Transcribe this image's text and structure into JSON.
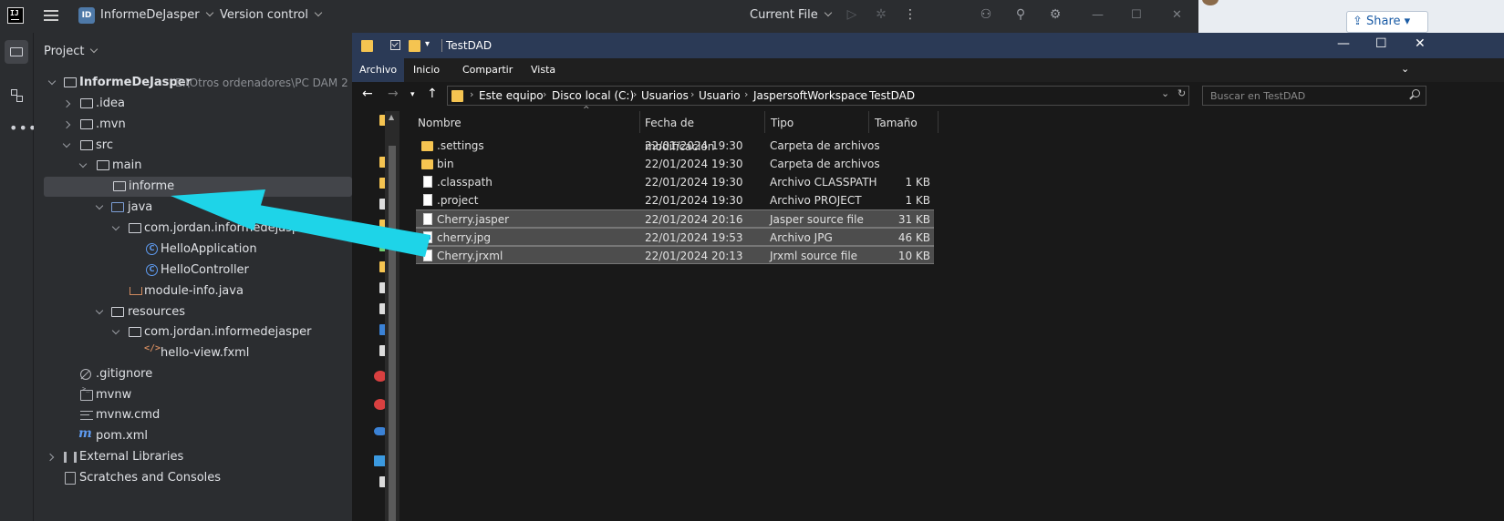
{
  "ide": {
    "logo": "IJ",
    "project_badge": "ID",
    "project_name": "InformeDeJasper",
    "vcs_label": "Version control",
    "run_config": "Current File",
    "panel_title": "Project",
    "tree": [
      {
        "label": "InformeDeJasper",
        "hint": "E:\\Otros ordenadores\\PC DAM 2"
      },
      {
        "label": ".idea"
      },
      {
        "label": ".mvn"
      },
      {
        "label": "src"
      },
      {
        "label": "main"
      },
      {
        "label": "informe"
      },
      {
        "label": "java"
      },
      {
        "label": "com.jordan.informedejasper"
      },
      {
        "label": "HelloApplication"
      },
      {
        "label": "HelloController"
      },
      {
        "label": "module-info.java"
      },
      {
        "label": "resources"
      },
      {
        "label": "com.jordan.informedejasper"
      },
      {
        "label": "hello-view.fxml"
      },
      {
        "label": ".gitignore"
      },
      {
        "label": "mvnw"
      },
      {
        "label": "mvnw.cmd"
      },
      {
        "label": "pom.xml"
      },
      {
        "label": "External Libraries"
      },
      {
        "label": "Scratches and Consoles"
      }
    ]
  },
  "browser": {
    "share_label": "Share"
  },
  "explorer": {
    "title": "TestDAD",
    "ribbon": [
      "Archivo",
      "Inicio",
      "Compartir",
      "Vista"
    ],
    "breadcrumb": [
      "Este equipo",
      "Disco local (C:)",
      "Usuarios",
      "Usuario",
      "JaspersoftWorkspace",
      "TestDAD"
    ],
    "search_placeholder": "Buscar en TestDAD",
    "columns": [
      "Nombre",
      "Fecha de modificación",
      "Tipo",
      "Tamaño"
    ],
    "files": [
      {
        "name": ".settings",
        "date": "22/01/2024 19:30",
        "type": "Carpeta de archivos",
        "size": "",
        "kind": "folder",
        "selected": false
      },
      {
        "name": "bin",
        "date": "22/01/2024 19:30",
        "type": "Carpeta de archivos",
        "size": "",
        "kind": "folder",
        "selected": false
      },
      {
        "name": ".classpath",
        "date": "22/01/2024 19:30",
        "type": "Archivo CLASSPATH",
        "size": "1 KB",
        "kind": "file",
        "selected": false
      },
      {
        "name": ".project",
        "date": "22/01/2024 19:30",
        "type": "Archivo PROJECT",
        "size": "1 KB",
        "kind": "file",
        "selected": false
      },
      {
        "name": "Cherry.jasper",
        "date": "22/01/2024 20:16",
        "type": "Jasper source file",
        "size": "31 KB",
        "kind": "file",
        "selected": true
      },
      {
        "name": "cherry.jpg",
        "date": "22/01/2024 19:53",
        "type": "Archivo JPG",
        "size": "46 KB",
        "kind": "image",
        "selected": true
      },
      {
        "name": "Cherry.jrxml",
        "date": "22/01/2024 20:13",
        "type": "Jrxml source file",
        "size": "10 KB",
        "kind": "file",
        "selected": true
      }
    ]
  },
  "colors": {
    "annotation_arrow": "#1ed4e8",
    "ide_bg": "#2b2d30",
    "explorer_title": "#2b3a56"
  }
}
